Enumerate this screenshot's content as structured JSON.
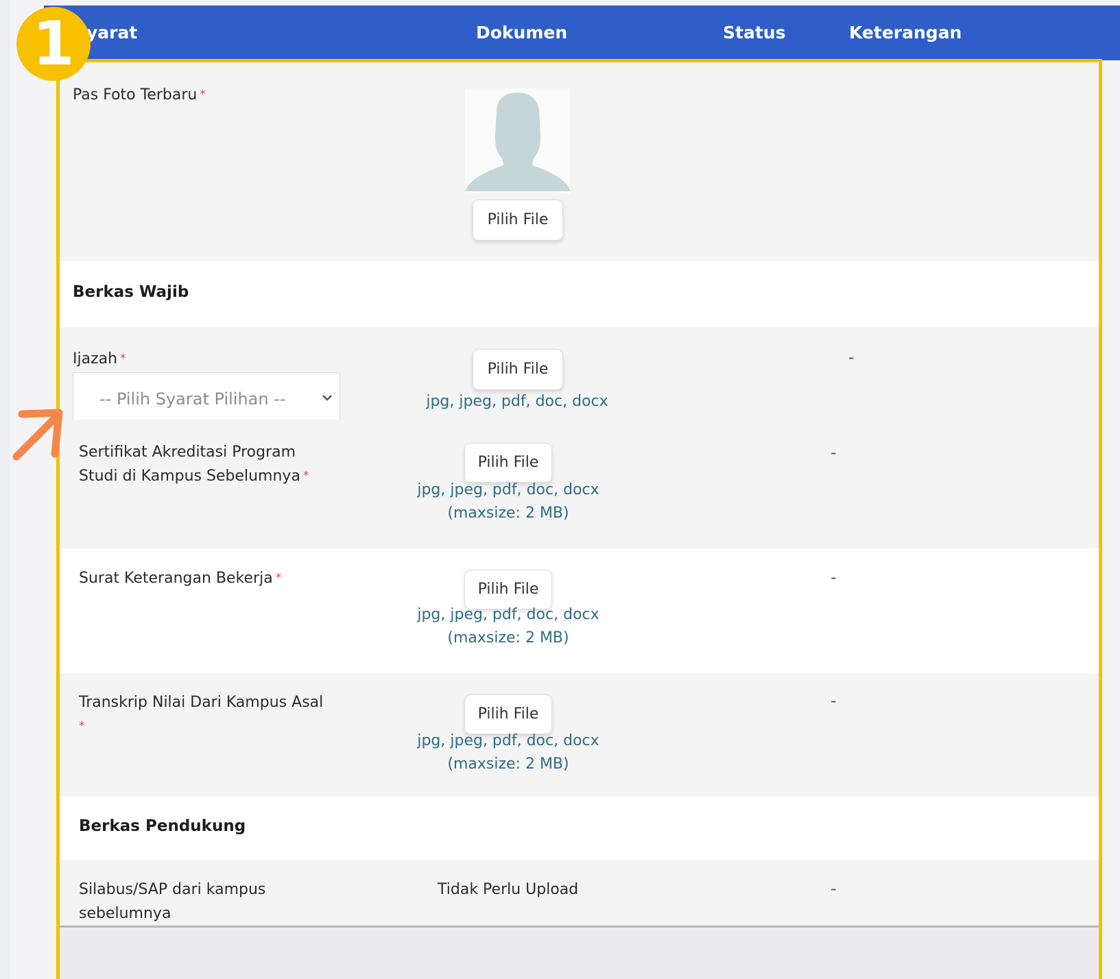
{
  "header": {
    "col_syarat": "yarat",
    "col_dokumen": "Dokumen",
    "col_status": "Status",
    "col_keterangan": "Keterangan"
  },
  "badge": "1",
  "pas_foto": {
    "label": "Pas Foto Terbaru",
    "required": "*",
    "button": "Pilih File"
  },
  "section_wajib": "Berkas Wajib",
  "ijazah": {
    "label": "Ijazah",
    "required": "*",
    "select_placeholder": "-- Pilih Syarat Pilihan --",
    "button": "Pilih File",
    "types": "jpg, jpeg, pdf, doc, docx",
    "status": "-"
  },
  "rows": [
    {
      "label_line1": "Sertifikat Akreditasi Program",
      "label_line2": "Studi di Kampus Sebelumnya",
      "required": "*",
      "button": "Pilih File",
      "types": "jpg, jpeg, pdf, doc, docx",
      "maxsize": "(maxsize: 2 MB)",
      "status": "-"
    },
    {
      "label_line1": "Surat Keterangan Bekerja",
      "required": "*",
      "button": "Pilih File",
      "types": "jpg, jpeg, pdf, doc, docx",
      "maxsize": "(maxsize: 2 MB)",
      "status": "-"
    },
    {
      "label_line1": "Transkrip Nilai Dari Kampus Asal",
      "required": "*",
      "button": "Pilih File",
      "types": "jpg, jpeg, pdf, doc, docx",
      "maxsize": "(maxsize: 2 MB)",
      "status": "-"
    }
  ],
  "section_pendukung": "Berkas Pendukung",
  "silabus": {
    "label_line1": "Silabus/SAP dari kampus",
    "label_line2": "sebelumnya",
    "document": "Tidak Perlu Upload",
    "status": "-"
  },
  "colors": {
    "header": "#2f5ec8",
    "highlight": "#f5c000",
    "arrow": "#f5874a",
    "link": "#2f6c85",
    "required": "#e0454e"
  },
  "icons": {
    "avatar": "avatar-placeholder-icon",
    "arrow": "arrow-up-right-icon",
    "select": "chevron-down-icon"
  }
}
